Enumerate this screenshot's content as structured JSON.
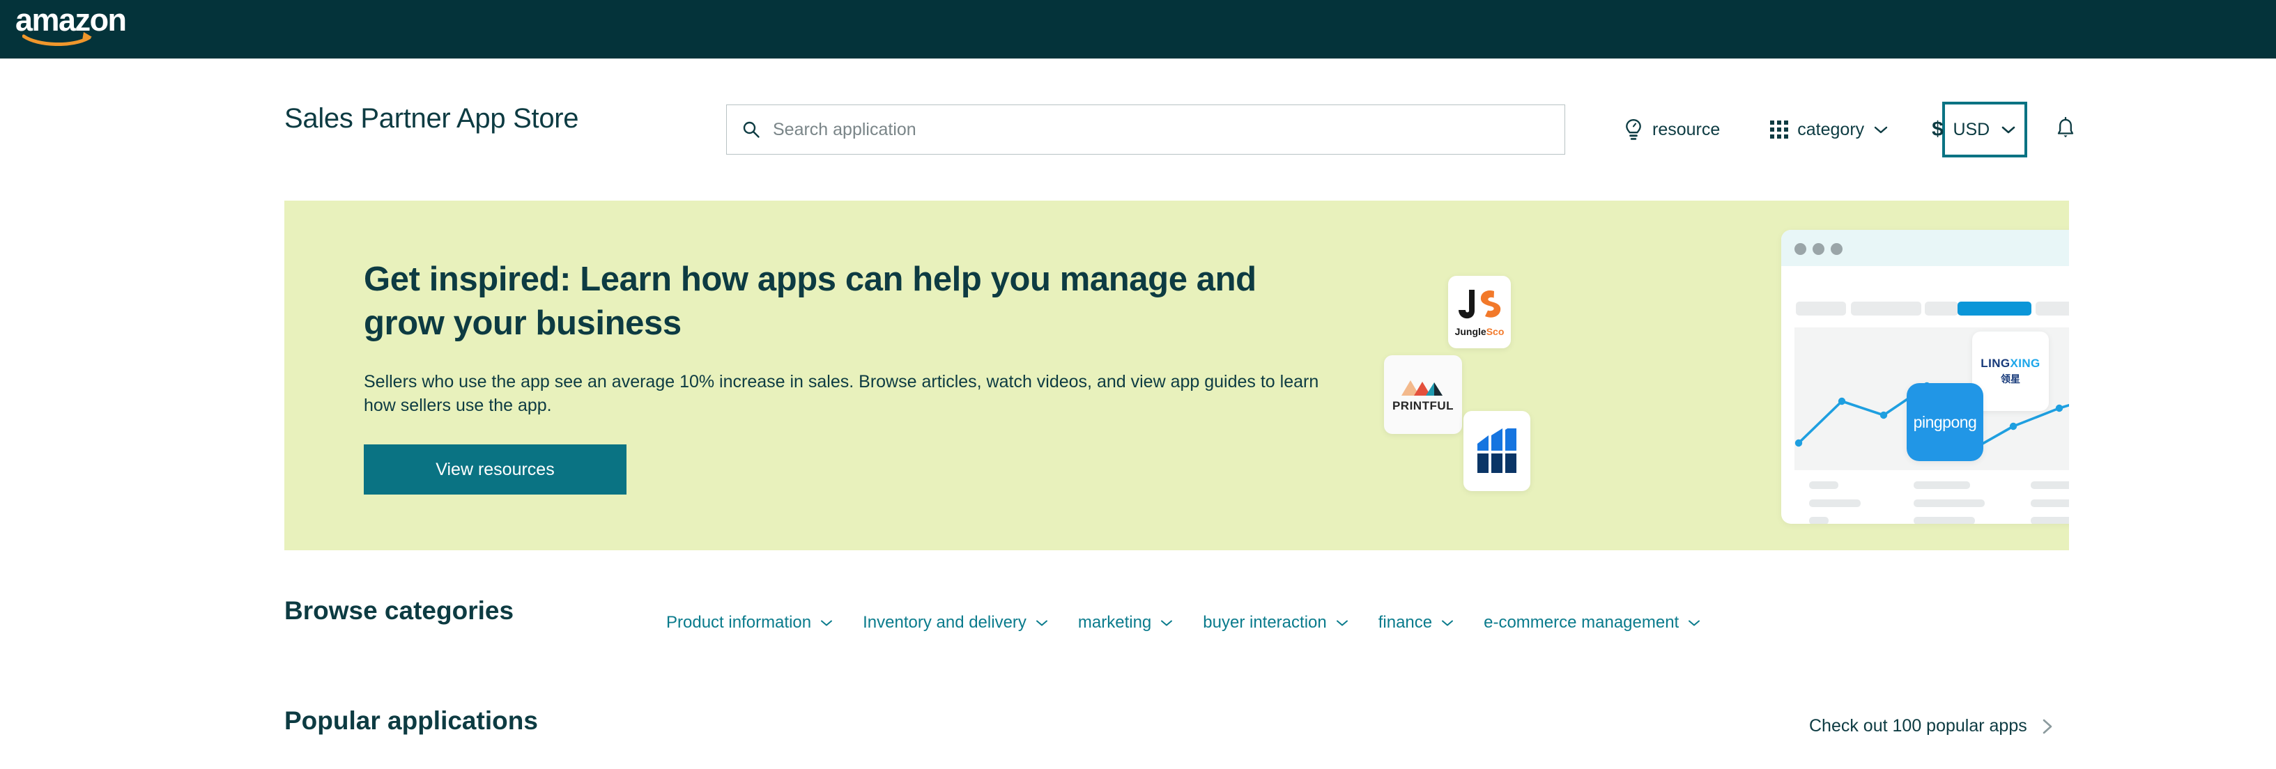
{
  "amazon_bar": {
    "logo_text": "amazon",
    "logo_name": "amazon-logo"
  },
  "header": {
    "brand_title": "Sales Partner App Store",
    "search": {
      "placeholder": "Search application",
      "value": "",
      "icon": "search-icon"
    },
    "resource": {
      "label": "resource",
      "icon": "lightbulb-icon"
    },
    "category": {
      "label": "category",
      "icon": "grid-icon",
      "chevron": "chevron-down-icon"
    },
    "currency": {
      "symbol": "$",
      "value": "USD",
      "chevron": "chevron-down-icon",
      "focus_color": "#0a7383"
    },
    "notifications": {
      "icon": "bell-icon"
    }
  },
  "hero": {
    "background": "#e8f1bc",
    "title": "Get inspired: Learn how apps can help you manage and grow your business",
    "subtitle": "Sellers who use the app see an average 10% increase in sales. Browse articles, watch videos, and view app guides to learn how sellers use the app.",
    "button_label": "View resources",
    "button_color": "#0a7383",
    "logos": [
      {
        "name": "junglescout-logo",
        "text_a": "Jungle",
        "text_b": "Sco"
      },
      {
        "name": "printful-logo",
        "text": "PRINTFUL"
      },
      {
        "name": "bar-chart-app-logo",
        "text": ""
      },
      {
        "name": "lingxing-logo",
        "text_a": "LING",
        "text_b": "XING",
        "text_cn": "领星"
      },
      {
        "name": "pingpong-logo",
        "text": "pingpong"
      }
    ],
    "mockup": {
      "window_dots": 3,
      "active_tab_color": "#0b96d8",
      "chart": {
        "type": "line",
        "title": "",
        "xlabel": "",
        "ylabel": "",
        "x": [
          1,
          2,
          3,
          4,
          5,
          6,
          7,
          8,
          9
        ],
        "values": [
          22,
          62,
          52,
          76,
          16,
          38,
          58,
          72,
          95
        ],
        "ylim": [
          0,
          100
        ],
        "series_color": "#1e9fe0",
        "grid": false,
        "legend": "none"
      }
    }
  },
  "browse": {
    "title": "Browse categories",
    "categories": [
      {
        "label": "Product information"
      },
      {
        "label": "Inventory and delivery"
      },
      {
        "label": "marketing"
      },
      {
        "label": "buyer interaction"
      },
      {
        "label": "finance"
      },
      {
        "label": "e-commerce management"
      }
    ]
  },
  "popular": {
    "title": "Popular applications",
    "link_label": "Check out 100 popular apps"
  }
}
